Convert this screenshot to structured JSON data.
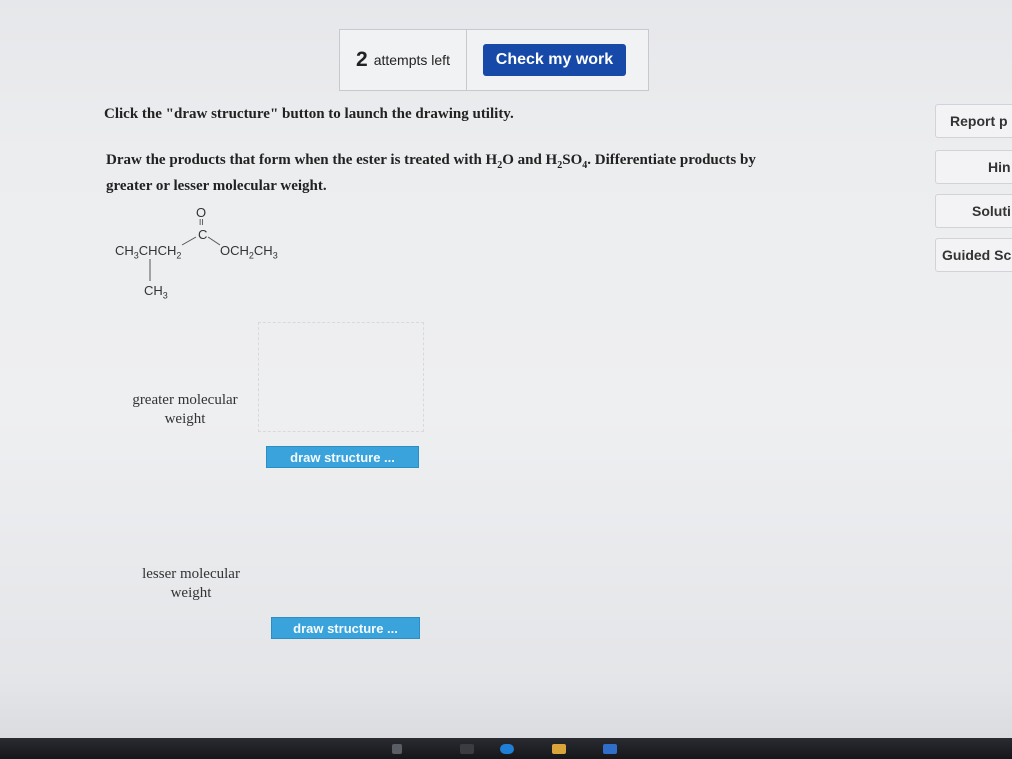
{
  "toolbar": {
    "attempts_count": "2",
    "attempts_text": "attempts left",
    "check_label": "Check my work"
  },
  "instruction": "Click the \"draw structure\" button to launch the drawing utility.",
  "question": {
    "part1": "Draw the products that form when the ester is treated with H",
    "sub1": "2",
    "part2": "O and H",
    "sub2": "2",
    "part3": "SO",
    "sub3": "4",
    "part4": ". Differentiate products by",
    "line2": "greater or lesser molecular weight."
  },
  "molecule": {
    "oxygen": "O",
    "double_bond": "II",
    "carbon": "C",
    "left": "CH",
    "left_sub": "3",
    "left_mid": "CHCH",
    "left_sub2": "2",
    "right": "OCH",
    "right_sub": "2",
    "right_mid": "CH",
    "right_sub2": "3",
    "branch": "CH",
    "branch_sub": "3"
  },
  "products": [
    {
      "label_line1": "greater molecular",
      "label_line2": "weight",
      "button": "draw structure ..."
    },
    {
      "label_line1": "lesser molecular",
      "label_line2": "weight",
      "button": "draw structure ..."
    }
  ],
  "sidebar": {
    "report": "Report p",
    "hint": "Hin",
    "solution": "Soluti",
    "guided": "Guided Sc"
  }
}
